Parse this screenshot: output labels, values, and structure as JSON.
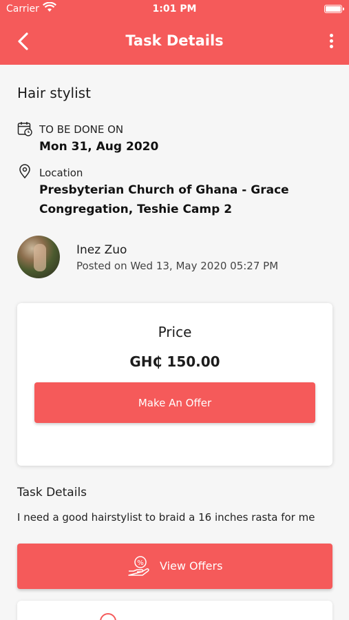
{
  "status_bar": {
    "carrier": "Carrier",
    "time": "1:01 PM"
  },
  "header": {
    "title": "Task Details"
  },
  "task": {
    "title": "Hair stylist",
    "date_label": "TO BE DONE ON",
    "date_value": "Mon 31, Aug 2020",
    "location_label": "Location",
    "location_line1": "Presbyterian Church of Ghana - Grace",
    "location_line2": "Congregation, Teshie Camp 2"
  },
  "poster": {
    "name": "Inez Zuo",
    "posted": "Posted on Wed 13, May 2020 05:27 PM"
  },
  "price_card": {
    "label": "Price",
    "amount": "GH₵ 150.00",
    "offer_button": "Make An Offer"
  },
  "details": {
    "heading": "Task Details",
    "description": "I need a good hairstylist to braid a 16 inches rasta for me"
  },
  "view_offers": {
    "label": "View Offers"
  },
  "colors": {
    "accent": "#f55a5a"
  }
}
